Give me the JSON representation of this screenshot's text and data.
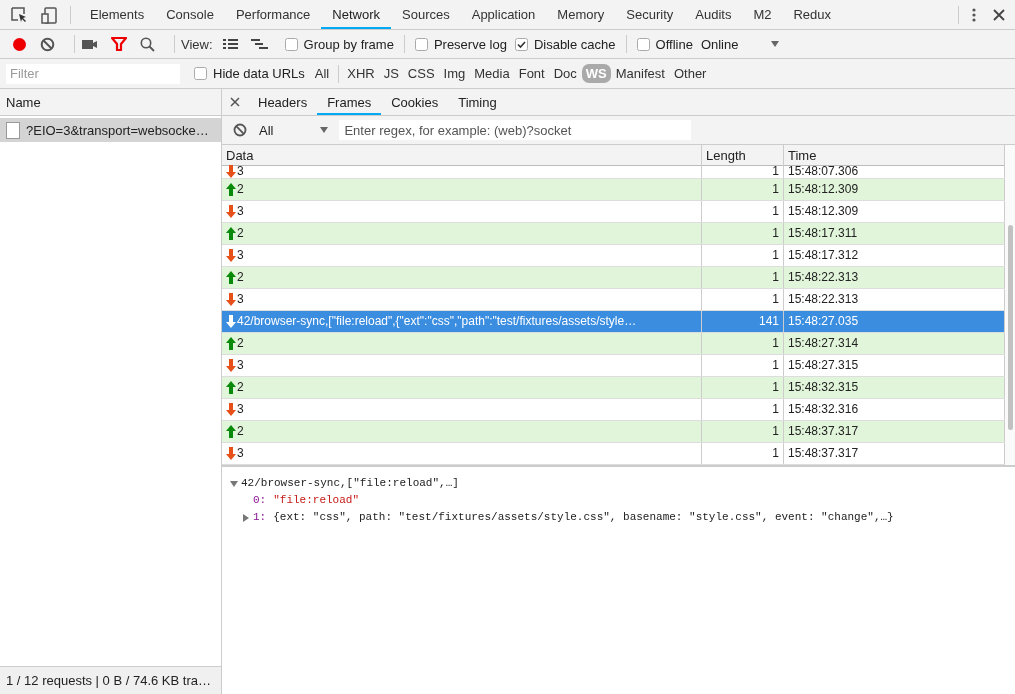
{
  "main_tabs": [
    {
      "label": "Elements",
      "selected": false
    },
    {
      "label": "Console",
      "selected": false
    },
    {
      "label": "Performance",
      "selected": false
    },
    {
      "label": "Network",
      "selected": true
    },
    {
      "label": "Sources",
      "selected": false
    },
    {
      "label": "Application",
      "selected": false
    },
    {
      "label": "Memory",
      "selected": false
    },
    {
      "label": "Security",
      "selected": false
    },
    {
      "label": "Audits",
      "selected": false
    },
    {
      "label": "M2",
      "selected": false
    },
    {
      "label": "Redux",
      "selected": false
    }
  ],
  "toolbar": {
    "recording": true,
    "view_label": "View:",
    "checkboxes": [
      {
        "label": "Group by frame",
        "checked": false
      },
      {
        "label": "Preserve log",
        "checked": false
      },
      {
        "label": "Disable cache",
        "checked": true
      },
      {
        "label": "Offline",
        "checked": false
      }
    ],
    "throttling": "Online"
  },
  "filter_bar": {
    "placeholder": "Filter",
    "hide_data_urls": {
      "label": "Hide data URLs",
      "checked": false
    },
    "types": [
      {
        "label": "All",
        "selected": false
      },
      {
        "label": "XHR",
        "selected": false
      },
      {
        "label": "JS",
        "selected": false
      },
      {
        "label": "CSS",
        "selected": false
      },
      {
        "label": "Img",
        "selected": false
      },
      {
        "label": "Media",
        "selected": false
      },
      {
        "label": "Font",
        "selected": false
      },
      {
        "label": "Doc",
        "selected": false
      },
      {
        "label": "WS",
        "selected": true
      },
      {
        "label": "Manifest",
        "selected": false
      },
      {
        "label": "Other",
        "selected": false
      }
    ]
  },
  "requests": {
    "header": "Name",
    "items": [
      {
        "name": "?EIO=3&transport=websocke…",
        "selected": true
      }
    ],
    "status": "1 / 12 requests | 0 B / 74.6 KB tra…"
  },
  "detail_tabs": [
    {
      "label": "Headers",
      "selected": false
    },
    {
      "label": "Frames",
      "selected": true
    },
    {
      "label": "Cookies",
      "selected": false
    },
    {
      "label": "Timing",
      "selected": false
    }
  ],
  "frames_filter": {
    "option": "All",
    "placeholder": "Enter regex, for example: (web)?socket"
  },
  "frames": {
    "columns": [
      "Data",
      "Length",
      "Time"
    ],
    "rows": [
      {
        "kind": "received",
        "data": "3",
        "length": "1",
        "time": "15:48:07.306",
        "selected": false
      },
      {
        "kind": "sent",
        "data": "2",
        "length": "1",
        "time": "15:48:12.309",
        "selected": false
      },
      {
        "kind": "received",
        "data": "3",
        "length": "1",
        "time": "15:48:12.309",
        "selected": false
      },
      {
        "kind": "sent",
        "data": "2",
        "length": "1",
        "time": "15:48:17.311",
        "selected": false
      },
      {
        "kind": "received",
        "data": "3",
        "length": "1",
        "time": "15:48:17.312",
        "selected": false
      },
      {
        "kind": "sent",
        "data": "2",
        "length": "1",
        "time": "15:48:22.313",
        "selected": false
      },
      {
        "kind": "received",
        "data": "3",
        "length": "1",
        "time": "15:48:22.313",
        "selected": false
      },
      {
        "kind": "received",
        "data": "42/browser-sync,[\"file:reload\",{\"ext\":\"css\",\"path\":\"test/fixtures/assets/style…",
        "length": "141",
        "time": "15:48:27.035",
        "selected": true
      },
      {
        "kind": "sent",
        "data": "2",
        "length": "1",
        "time": "15:48:27.314",
        "selected": false
      },
      {
        "kind": "received",
        "data": "3",
        "length": "1",
        "time": "15:48:27.315",
        "selected": false
      },
      {
        "kind": "sent",
        "data": "2",
        "length": "1",
        "time": "15:48:32.315",
        "selected": false
      },
      {
        "kind": "received",
        "data": "3",
        "length": "1",
        "time": "15:48:32.316",
        "selected": false
      },
      {
        "kind": "sent",
        "data": "2",
        "length": "1",
        "time": "15:48:37.317",
        "selected": false
      },
      {
        "kind": "received",
        "data": "3",
        "length": "1",
        "time": "15:48:37.317",
        "selected": false
      }
    ]
  },
  "message": {
    "label": "42/browser-sync,[\"file:reload\",…]",
    "expanded": true,
    "children": [
      {
        "key": "0:",
        "value": "\"file:reload\"",
        "kind": "string"
      },
      {
        "key": "1:",
        "value": "{ext: \"css\", path: \"test/fixtures/assets/style.css\", basename: \"style.css\", event: \"change\",…}",
        "kind": "object",
        "expanded": false
      }
    ]
  }
}
